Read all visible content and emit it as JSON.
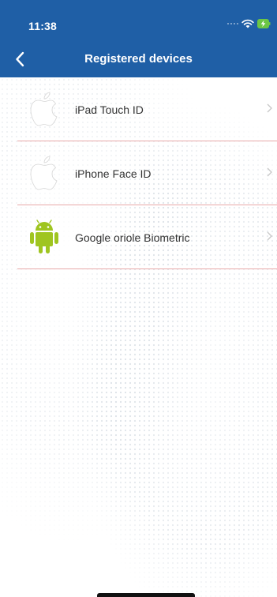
{
  "status_bar": {
    "time": "11:38"
  },
  "nav": {
    "title": "Registered devices"
  },
  "devices": [
    {
      "label": "iPad Touch ID",
      "icon": "apple-logo-icon"
    },
    {
      "label": "iPhone Face ID",
      "icon": "apple-logo-icon"
    },
    {
      "label": "Google oriole Biometric",
      "icon": "android-robot-icon"
    }
  ],
  "colors": {
    "header": "#1f5fa6",
    "divider": "#e8a9a9",
    "android_green": "#9fc520"
  }
}
